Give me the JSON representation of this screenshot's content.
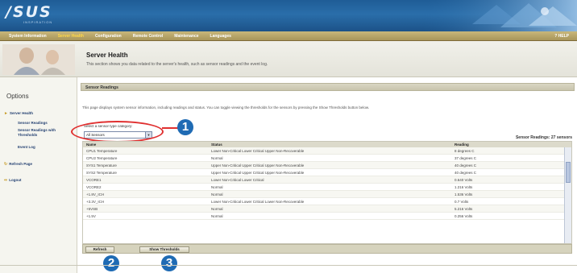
{
  "header": {
    "logo": "/SUS",
    "logo_tagline": "INSPIRATION"
  },
  "nav": {
    "items": [
      {
        "label": "System Information",
        "active": false
      },
      {
        "label": "Server Health",
        "active": true
      },
      {
        "label": "Configuration",
        "active": false
      },
      {
        "label": "Remote Control",
        "active": false
      },
      {
        "label": "Maintenance",
        "active": false
      },
      {
        "label": "Languages",
        "active": false
      }
    ],
    "help": "? HELP"
  },
  "banner": {
    "title": "Server Health",
    "description": "This section shows you data related to the server's health, such as sensor readings and the event log."
  },
  "sidebar": {
    "options_title": "Options",
    "items": [
      {
        "label": "Server Health",
        "icon": "arrow-icon"
      },
      {
        "label": "Sensor Readings"
      },
      {
        "label": "Sensor Readings with Thresholds"
      },
      {
        "label": "Event Log"
      },
      {
        "label": "Refresh Page",
        "icon": "refresh-icon"
      },
      {
        "label": "Logout",
        "icon": "logout-icon"
      }
    ]
  },
  "main": {
    "section_title": "Sensor Readings",
    "intro": "This page displays system sensor information, including readings and status. You can toggle viewing the thresholds for the sensors by pressing the Show Thresholds button below.",
    "filter": {
      "label": "Select a sensor type category:",
      "selected": "All Sensors"
    },
    "count_label": "Sensor Readings: 27 sensors",
    "table": {
      "headers": [
        "Name",
        "Status",
        "Reading"
      ],
      "rows": [
        [
          "CPU1 Temperature",
          "Lower Non-Critical Lower Critical Upper Non-Recoverable",
          "8 degrees C"
        ],
        [
          "CPU2 Temperature",
          "Normal",
          "37 degrees C"
        ],
        [
          "SYS1 Temperature",
          "Upper Non-Critical Upper Critical Upper Non-Recoverable",
          "40 degrees C"
        ],
        [
          "SYS2 Temperature",
          "Upper Non-Critical Upper Critical Upper Non-Recoverable",
          "40 degrees C"
        ],
        [
          "VCORE1",
          "Lower Non-Critical Lower Critical",
          "0.640 Volts"
        ],
        [
          "VCORE2",
          "Normal",
          "1.216 Volts"
        ],
        [
          "+1.8V_ICH",
          "Normal",
          "1.536 Volts"
        ],
        [
          "+3.3V_ICH",
          "Lower Non-Critical Lower Critical Lower Non-Recoverable",
          "0.7 Volts"
        ],
        [
          "+5VSB",
          "Normal",
          "5.216 Volts"
        ],
        [
          "+1.5V",
          "Normal",
          "0.256 Volts"
        ]
      ]
    },
    "buttons": {
      "refresh": "Refresh",
      "show_thresholds": "Show Thresholds"
    }
  },
  "callouts": [
    "1",
    "2",
    "3"
  ],
  "colors": {
    "header_blue": "#1f5c96",
    "nav_gold": "#a8955a",
    "active_nav": "#ffd84a",
    "callout_blue": "#1f6bb4",
    "highlight_red": "#e03030"
  }
}
